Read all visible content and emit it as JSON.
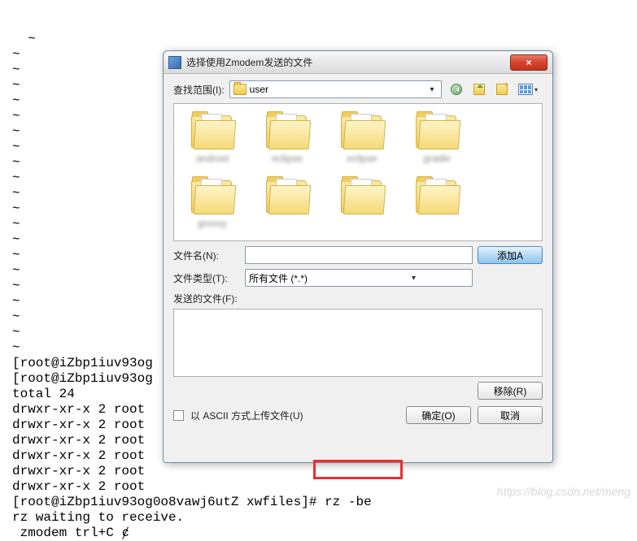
{
  "terminal": {
    "tildes": "~\n~\n~\n~\n~\n~\n~\n~\n~\n~\n~\n~\n~\n~\n~\n~\n~\n~\n~\n~\n~",
    "lines": "[root@iZbp1iuv93og\n[root@iZbp1iuv93og\ntotal 24\ndrwxr-xr-x 2 root\ndrwxr-xr-x 2 root\ndrwxr-xr-x 2 root\ndrwxr-xr-x 2 root\ndrwxr-xr-x 2 root\ndrwxr-xr-x 2 root\n[root@iZbp1iuv93og0o8vawj6utZ xwfiles]# rz -be\nrz waiting to receive.\n zmodem trl+C ȼ"
  },
  "dialog": {
    "title": "选择使用Zmodem发送的文件",
    "close": "×",
    "lookin_label": "查找范围(I):",
    "lookin_value": "user",
    "files": [
      {
        "label": "android"
      },
      {
        "label": "eclipse"
      },
      {
        "label": "eclipse"
      },
      {
        "label": "gradle"
      },
      {
        "label": "groovy"
      },
      {
        "label": ""
      },
      {
        "label": ""
      },
      {
        "label": ""
      },
      {
        "label": ""
      },
      {
        "label": ""
      }
    ],
    "filename_label": "文件名(N):",
    "filename_value": "",
    "filetype_label": "文件类型(T):",
    "filetype_value": "所有文件 (*.*)",
    "sendlist_label": "发送的文件(F):",
    "add_btn": "添加A",
    "remove_btn": "移除(R)",
    "ascii_label": "以 ASCII 方式上传文件(U)",
    "ok_btn": "确定(O)",
    "cancel_btn": "取消"
  },
  "watermark": "https://blog.csdn.net/meng"
}
